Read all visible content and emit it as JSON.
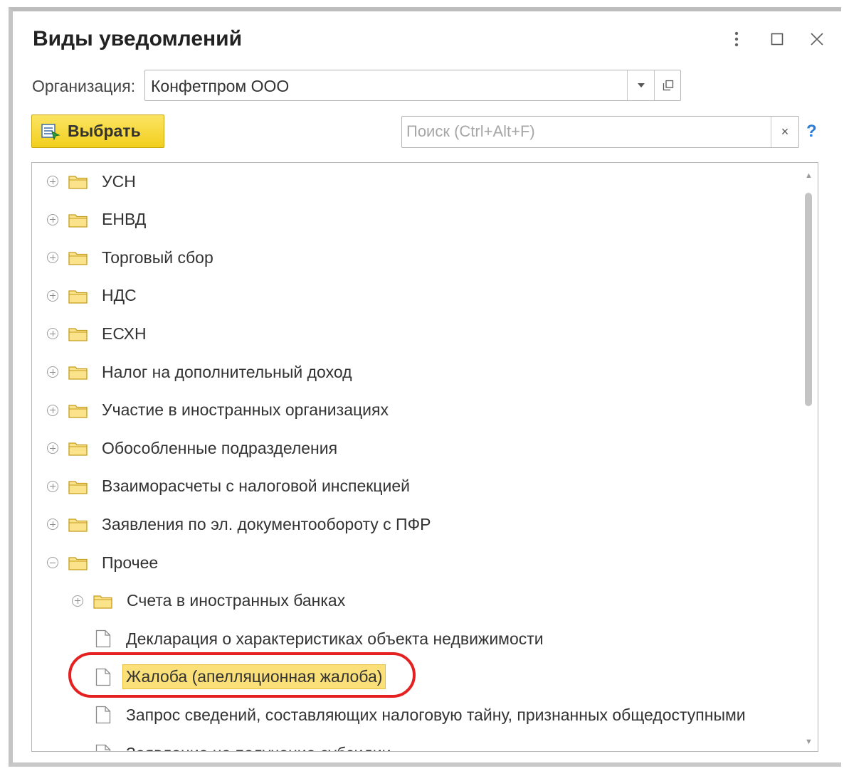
{
  "window": {
    "title": "Виды уведомлений",
    "menu_icon": "more-vertical-icon",
    "maximize_icon": "maximize-icon",
    "close_icon": "close-icon"
  },
  "organization": {
    "label": "Организация:",
    "value": "Конфетпром ООО",
    "dropdown_icon": "dropdown-arrow-icon",
    "open_icon": "open-form-icon"
  },
  "toolbar": {
    "select_label": "Выбрать",
    "select_icon": "select-list-icon",
    "search_placeholder": "Поиск (Ctrl+Alt+F)",
    "search_value": "",
    "clear_label": "×",
    "help_label": "?"
  },
  "tree": {
    "items": [
      {
        "label": "УСН",
        "kind": "folder",
        "expander": "plus",
        "level": 0
      },
      {
        "label": "ЕНВД",
        "kind": "folder",
        "expander": "plus",
        "level": 0
      },
      {
        "label": "Торговый сбор",
        "kind": "folder",
        "expander": "plus",
        "level": 0
      },
      {
        "label": "НДС",
        "kind": "folder",
        "expander": "plus",
        "level": 0
      },
      {
        "label": "ЕСХН",
        "kind": "folder",
        "expander": "plus",
        "level": 0
      },
      {
        "label": "Налог на дополнительный доход",
        "kind": "folder",
        "expander": "plus",
        "level": 0
      },
      {
        "label": "Участие в иностранных организациях",
        "kind": "folder",
        "expander": "plus",
        "level": 0
      },
      {
        "label": "Обособленные подразделения",
        "kind": "folder",
        "expander": "plus",
        "level": 0
      },
      {
        "label": "Взаиморасчеты с налоговой инспекцией",
        "kind": "folder",
        "expander": "plus",
        "level": 0
      },
      {
        "label": "Заявления по эл. документообороту с ПФР",
        "kind": "folder",
        "expander": "plus",
        "level": 0
      },
      {
        "label": "Прочее",
        "kind": "folder",
        "expander": "minus",
        "level": 0
      },
      {
        "label": "Счета в иностранных банках",
        "kind": "folder",
        "expander": "plus",
        "level": 1
      },
      {
        "label": "Декларация о характеристиках объекта недвижимости",
        "kind": "doc",
        "level": 1
      },
      {
        "label": "Жалоба (апелляционная жалоба)",
        "kind": "doc",
        "level": 1,
        "selected": true
      },
      {
        "label": "Запрос сведений, составляющих налоговую тайну, признанных общедоступными",
        "kind": "doc",
        "level": 1
      },
      {
        "label": "Заявление на получение субсидии",
        "kind": "doc",
        "level": 1
      }
    ]
  },
  "colors": {
    "accent_button": "#f2cf1d",
    "selection": "#fbe07a",
    "annotation_ring": "#e52020",
    "help": "#2b7ad6"
  }
}
